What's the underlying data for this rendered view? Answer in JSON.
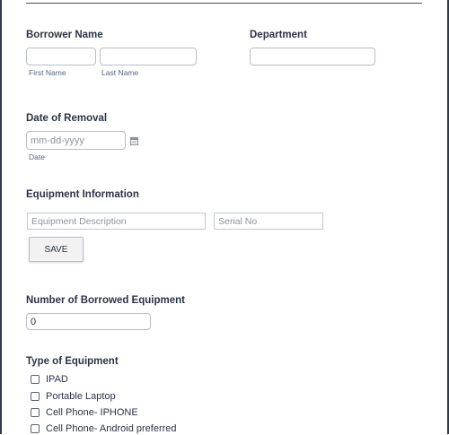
{
  "borrower": {
    "label": "Borrower Name",
    "first_sublabel": "First Name",
    "last_sublabel": "Last Name",
    "first_value": "",
    "last_value": ""
  },
  "department": {
    "label": "Department",
    "value": ""
  },
  "removal_date": {
    "label": "Date of Removal",
    "placeholder": "mm-dd-yyyy",
    "sublabel": "Date"
  },
  "equipment_info": {
    "label": "Equipment Information",
    "description_placeholder": "Equipment Description",
    "serial_placeholder": "Serial No",
    "save_label": "SAVE"
  },
  "borrowed_count": {
    "label": "Number of Borrowed Equipment",
    "value": "0"
  },
  "equipment_type": {
    "label": "Type of Equipment",
    "options": [
      {
        "label": "IPAD",
        "checked": false
      },
      {
        "label": "Portable Laptop",
        "checked": false
      },
      {
        "label": "Cell Phone- IPHONE",
        "checked": false
      },
      {
        "label": "Cell Phone- Android preferred",
        "checked": false
      }
    ]
  }
}
